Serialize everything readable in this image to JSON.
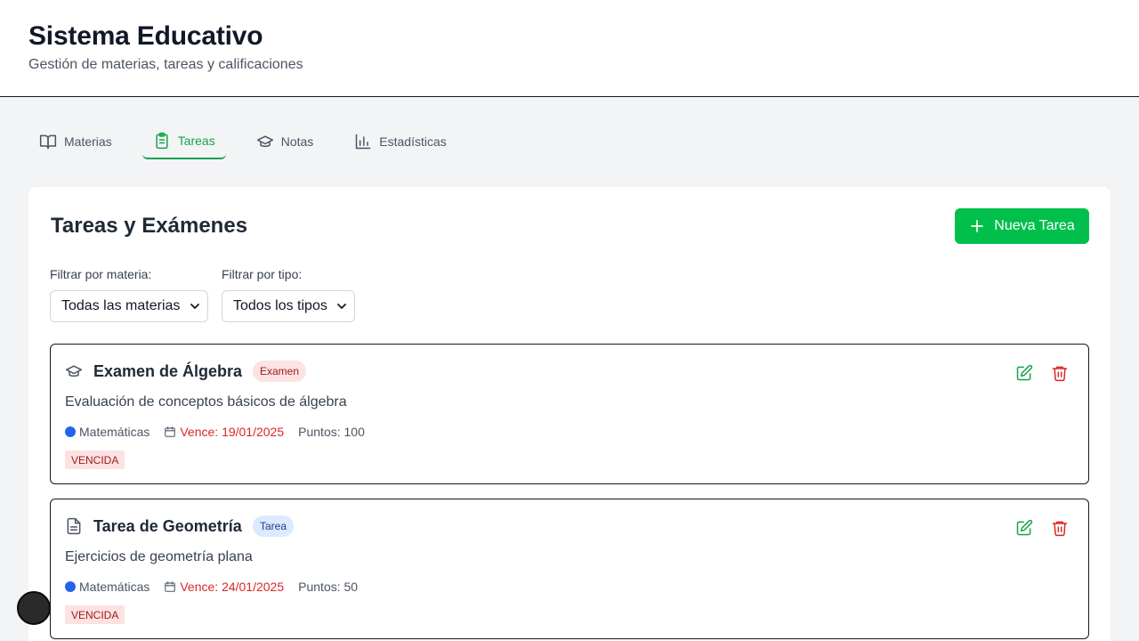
{
  "header": {
    "title": "Sistema Educativo",
    "subtitle": "Gestión de materias, tareas y calificaciones"
  },
  "tabs": [
    {
      "label": "Materias",
      "icon": "book-icon"
    },
    {
      "label": "Tareas",
      "icon": "clipboard-icon",
      "active": true
    },
    {
      "label": "Notas",
      "icon": "graduation-cap-icon"
    },
    {
      "label": "Estadísticas",
      "icon": "bar-chart-icon"
    }
  ],
  "panel": {
    "title": "Tareas y Exámenes",
    "new_button": "Nueva Tarea"
  },
  "filters": {
    "subject_label": "Filtrar por materia:",
    "subject_value": "Todas las materias",
    "type_label": "Filtrar por tipo:",
    "type_value": "Todos los tipos"
  },
  "tasks": [
    {
      "title": "Examen de Álgebra",
      "badge": "Examen",
      "description": "Evaluación de conceptos básicos de álgebra",
      "subject": "Matemáticas",
      "due": "Vence: 19/01/2025",
      "points": "Puntos: 100",
      "status": "VENCIDA",
      "icon": "graduation-cap-icon"
    },
    {
      "title": "Tarea de Geometría",
      "badge": "Tarea",
      "description": "Ejercicios de geometría plana",
      "subject": "Matemáticas",
      "due": "Vence: 24/01/2025",
      "points": "Puntos: 50",
      "status": "VENCIDA",
      "icon": "document-icon"
    }
  ],
  "colors": {
    "accent": "#00c04b",
    "danger": "#dc2626",
    "subject_dot": "#2563eb"
  }
}
